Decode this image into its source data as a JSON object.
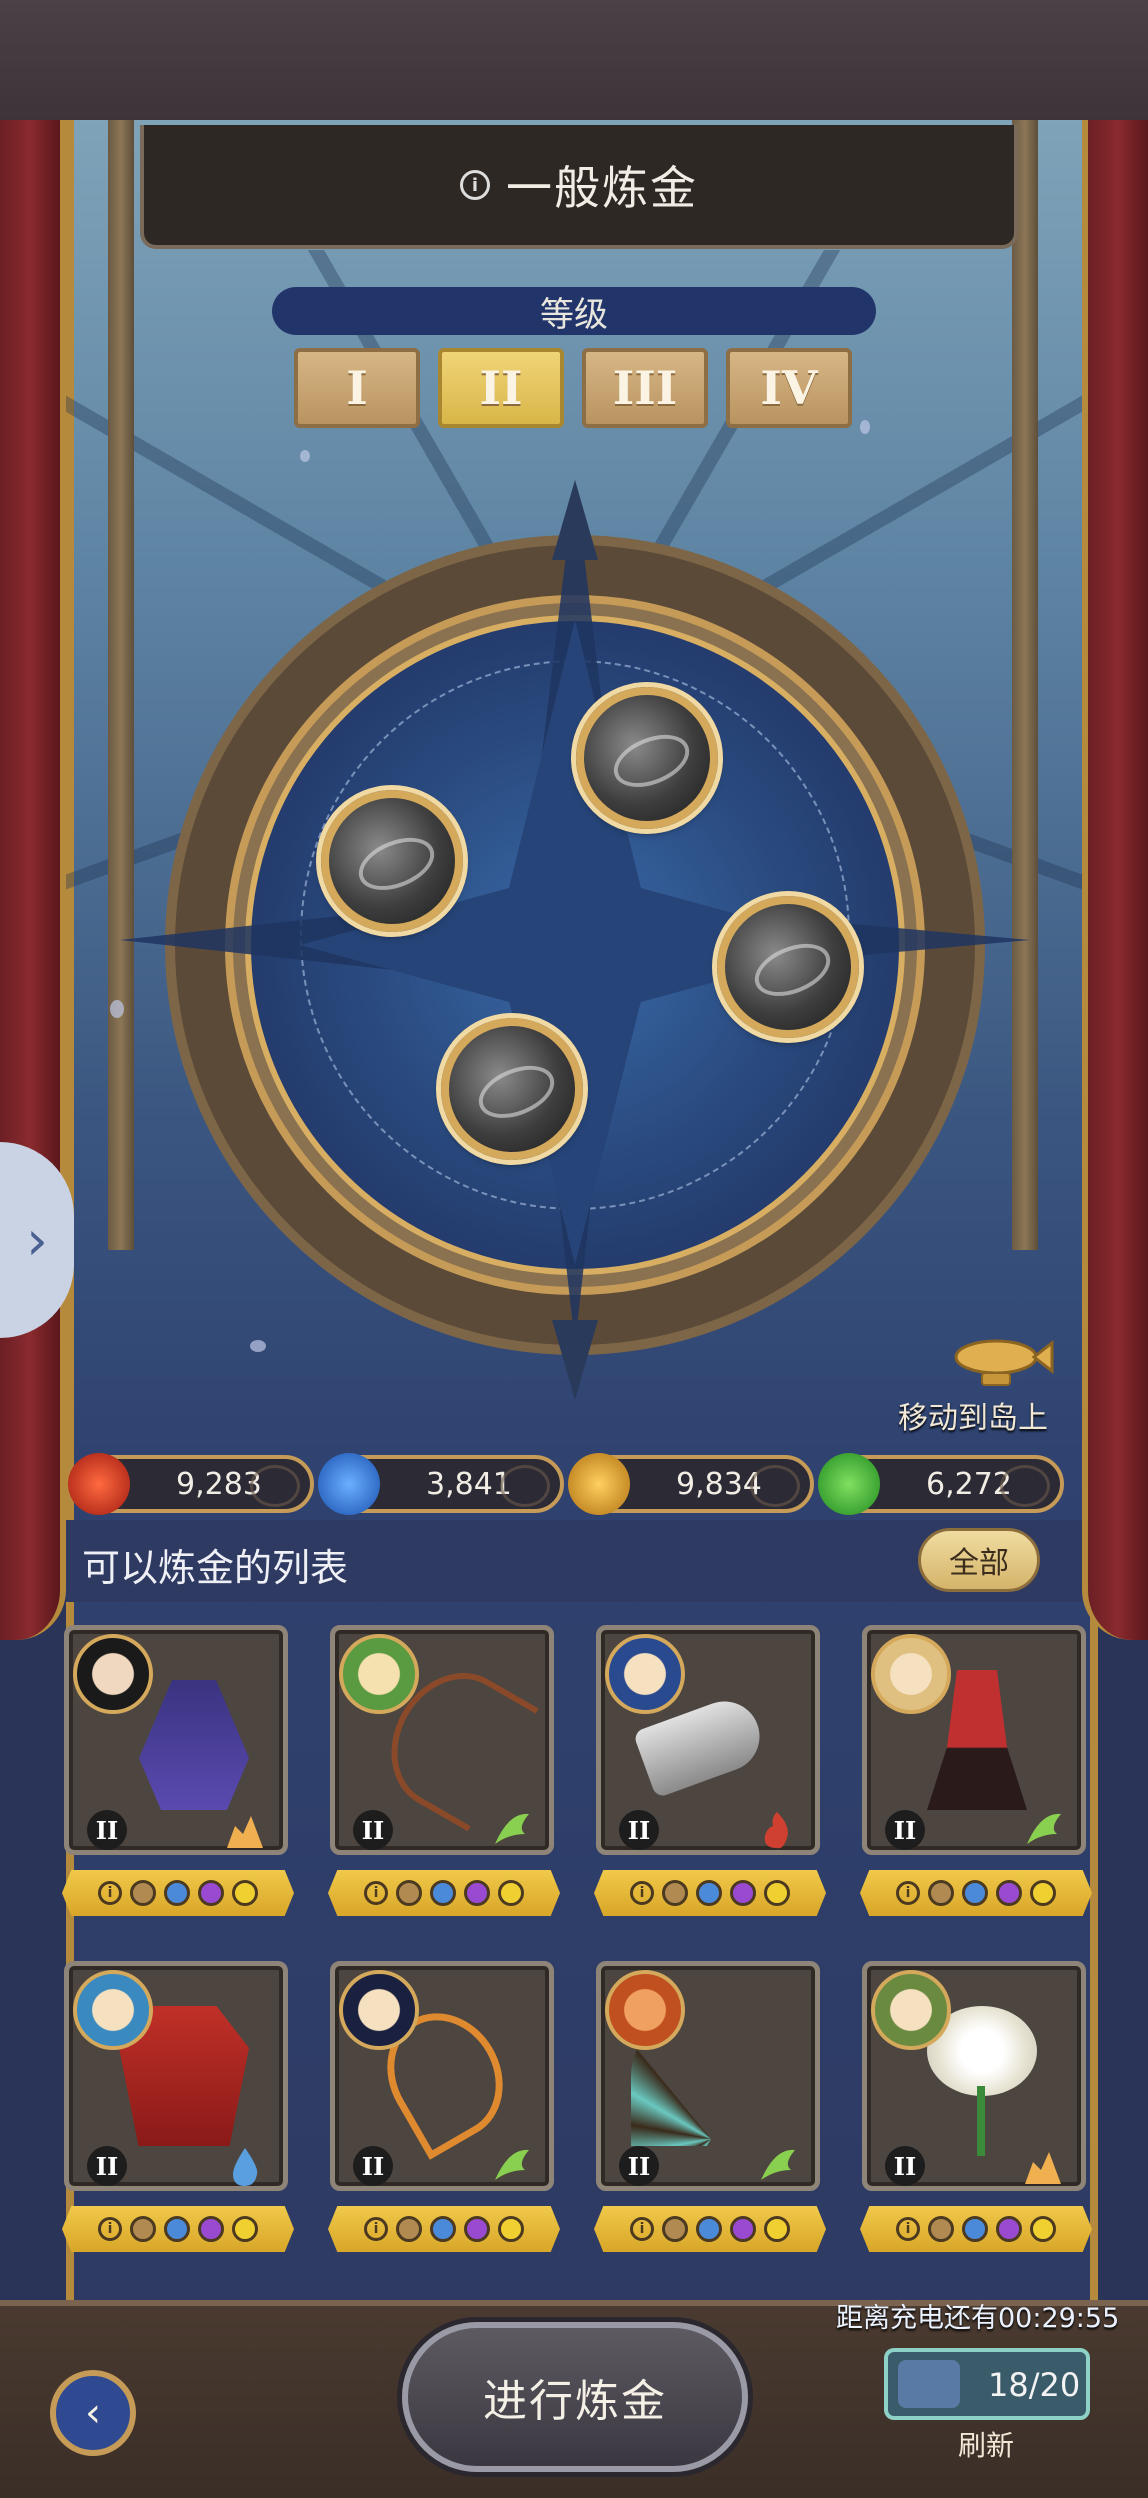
{
  "header": {
    "title": "一般炼金"
  },
  "level": {
    "label": "等级",
    "tabs": [
      "I",
      "II",
      "III",
      "IV"
    ],
    "selected": "II"
  },
  "map_action": {
    "label": "移动到岛上"
  },
  "resources": [
    {
      "name": "red-gem",
      "value": "9,283",
      "color": "#c0301c"
    },
    {
      "name": "blue-gem",
      "value": "3,841",
      "color": "#2f7be0"
    },
    {
      "name": "gold-gem",
      "value": "9,834",
      "color": "#e0a020"
    },
    {
      "name": "green-gem",
      "value": "6,272",
      "color": "#3fb83a"
    }
  ],
  "list": {
    "title": "可以炼金的列表",
    "filter_label": "全部",
    "items": [
      {
        "tier": "II",
        "element": "earth"
      },
      {
        "tier": "II",
        "element": "wind"
      },
      {
        "tier": "II",
        "element": "fire"
      },
      {
        "tier": "II",
        "element": "wind"
      },
      {
        "tier": "II",
        "element": "water"
      },
      {
        "tier": "II",
        "element": "wind"
      },
      {
        "tier": "II",
        "element": "wind"
      },
      {
        "tier": "II",
        "element": "earth"
      }
    ]
  },
  "footer": {
    "charge_timer": "距离充电还有00:29:55",
    "energy_count": "18/20",
    "refresh_label": "刷新",
    "go_label": "进行炼金"
  },
  "colors": {
    "accent_gold": "#d4a95c",
    "selected_tab": "#e8c860",
    "panel_navy": "#22356a"
  }
}
